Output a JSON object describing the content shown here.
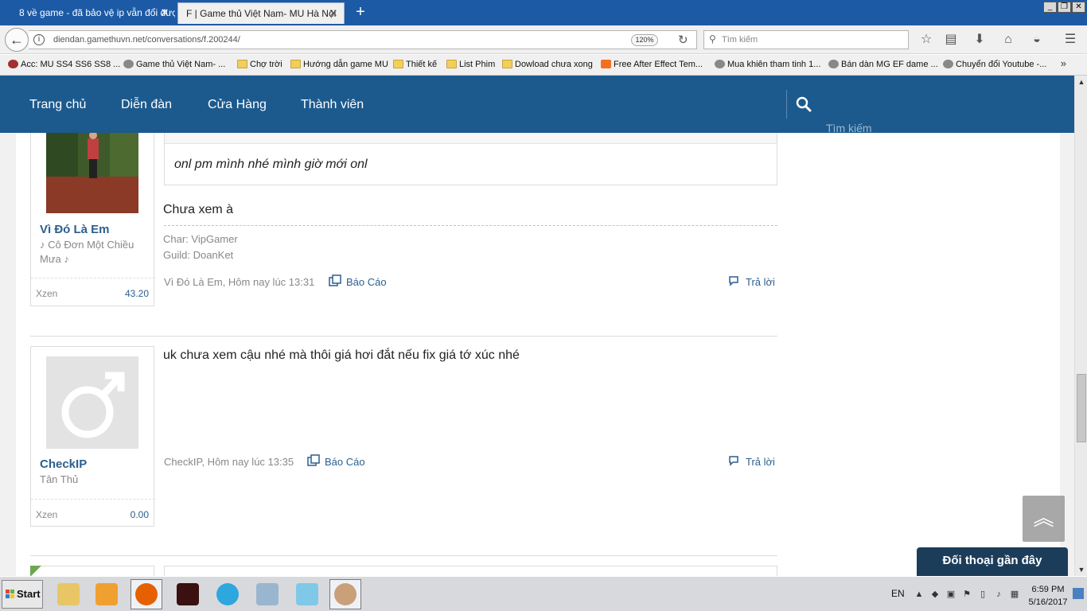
{
  "browser": {
    "tabs": [
      {
        "title": "8 về game - đã bảo vệ ip vẫn đổi đượ"
      },
      {
        "title": "F | Game thủ Việt Nam- MU Hà Nội"
      }
    ],
    "url": "diendan.gamethuvn.net/conversations/f.200244/",
    "zoom": "120%",
    "search_placeholder": "Tìm kiếm",
    "bookmarks": [
      {
        "label": "Acc: MU SS4 SS6 SS8 ...",
        "icon": "mu"
      },
      {
        "label": "Game thủ Việt Nam- ...",
        "icon": "globe"
      },
      {
        "label": "Chợ trời",
        "icon": "folder"
      },
      {
        "label": "Hướng dẫn game MU",
        "icon": "folder"
      },
      {
        "label": "Thiết kế",
        "icon": "folder"
      },
      {
        "label": "List Phim",
        "icon": "folder"
      },
      {
        "label": "Dowload chưa xong",
        "icon": "folder"
      },
      {
        "label": "Free After Effect Tem...",
        "icon": "blogger"
      },
      {
        "label": "Mua khiên tham tinh 1...",
        "icon": "globe"
      },
      {
        "label": "Bán dàn MG EF dame ...",
        "icon": "globe"
      },
      {
        "label": "Chuyển đổi Youtube -...",
        "icon": "globe"
      }
    ],
    "bookmarks_more": "»"
  },
  "site_nav": {
    "items": [
      "Trang chủ",
      "Diễn đàn",
      "Cửa Hàng",
      "Thành viên"
    ],
    "search_label": "Tìm kiếm"
  },
  "messages": [
    {
      "quote_text": "onl pm mình nhé mình giờ mới onl",
      "text": "Chưa xem à",
      "signature": [
        "Char: VipGamer",
        "Guild: DoanKet"
      ],
      "author": "Vì Đó Là Em",
      "user_title": "♪ Cô Đơn Một Chiều Mưa ♪",
      "stat_label": "Xzen",
      "stat_value": "43.20",
      "meta": "Vì Đó Là Em, Hôm nay lúc 13:31",
      "report": "Báo Cáo",
      "reply": "Trả lời"
    },
    {
      "text": "uk chưa xem cậu nhé mà thôi giá hơi đắt nếu fix giá tớ xúc nhé",
      "author": "CheckIP",
      "user_title": "Tân Thủ",
      "stat_label": "Xzen",
      "stat_value": "0.00",
      "meta": "CheckIP, Hôm nay lúc 13:35",
      "report": "Báo Cáo",
      "reply": "Trả lời"
    }
  ],
  "recent_conversations": "Đối thoại gần đây",
  "taskbar": {
    "start": "Start",
    "lang": "EN",
    "time": "6:59 PM",
    "date": "5/16/2017"
  }
}
